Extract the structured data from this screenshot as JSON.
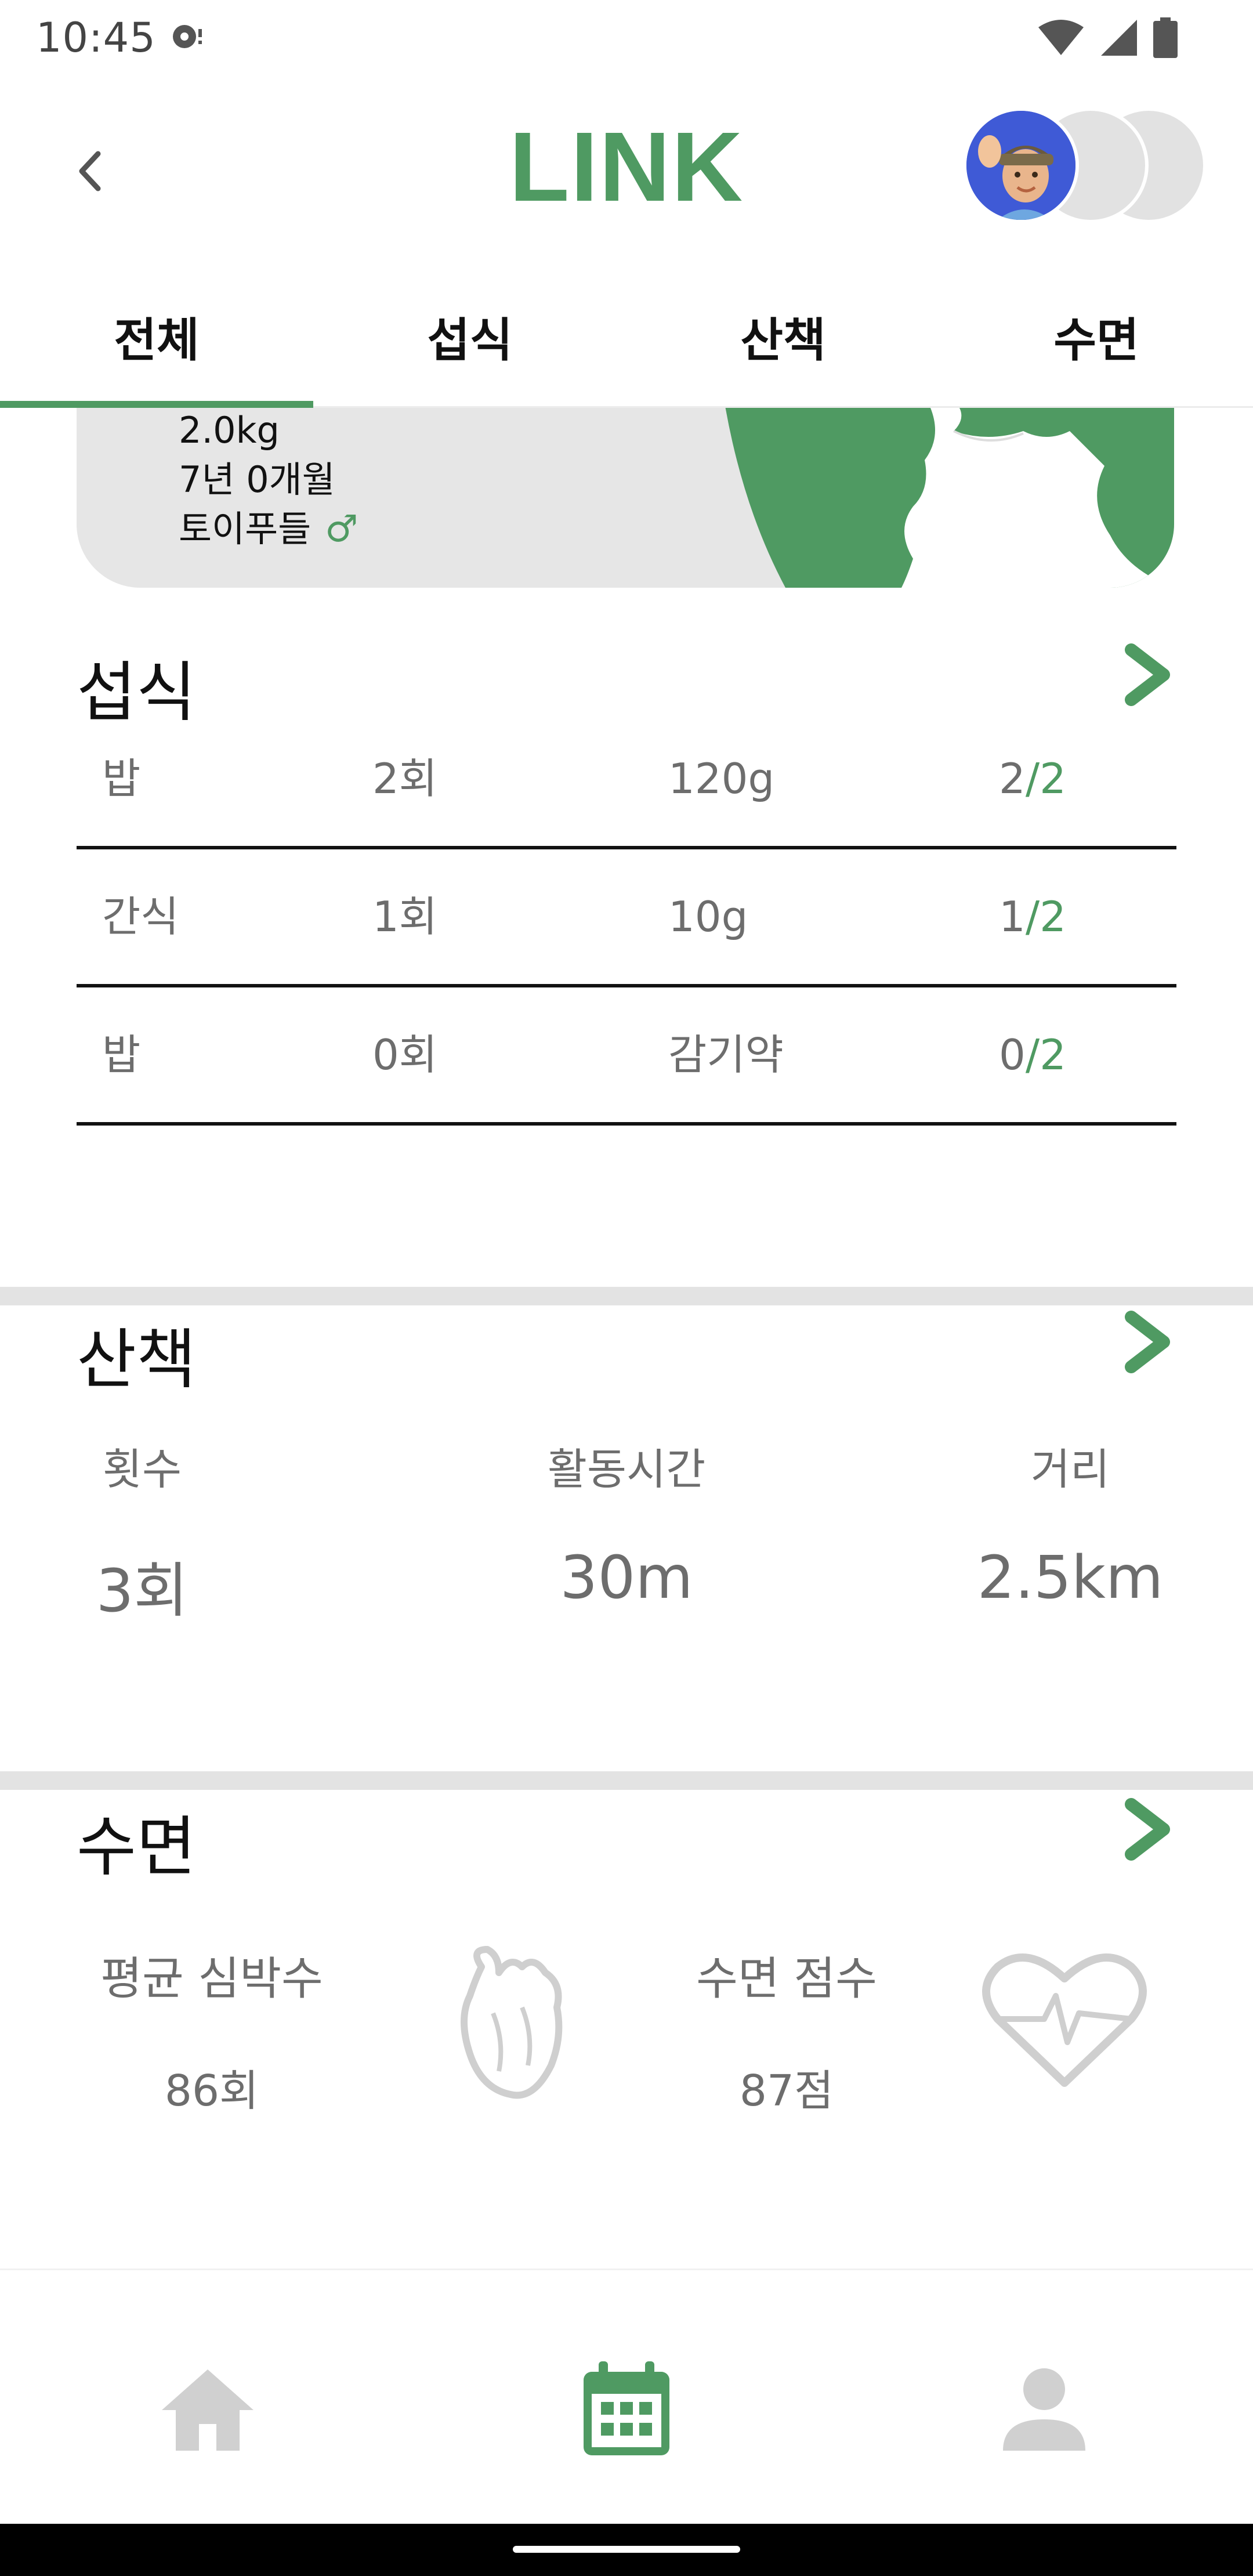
{
  "status_bar": {
    "time": "10:45"
  },
  "header": {
    "logo": "LINK"
  },
  "tabs": [
    {
      "label": "전체",
      "active": true
    },
    {
      "label": "섭식",
      "active": false
    },
    {
      "label": "산책",
      "active": false
    },
    {
      "label": "수면",
      "active": false
    }
  ],
  "pet": {
    "weight": "2.0kg",
    "age": "7년 0개월",
    "breed": "토이푸들",
    "gender_symbol": "♂"
  },
  "feeding": {
    "title": "섭식",
    "rows": [
      {
        "type": "밥",
        "count": "2회",
        "amount": "120g",
        "done": "2",
        "total": "/2"
      },
      {
        "type": "간식",
        "count": "1회",
        "amount": "10g",
        "done": "1",
        "total": "/2"
      },
      {
        "type": "밥",
        "count": "0회",
        "amount": "감기약",
        "done": "0",
        "total": "/2"
      }
    ]
  },
  "walk": {
    "title": "산책",
    "stats": [
      {
        "label": "횟수",
        "value": "3회"
      },
      {
        "label": "활동시간",
        "value": "30m"
      },
      {
        "label": "거리",
        "value": "2.5km"
      }
    ]
  },
  "sleep": {
    "title": "수면",
    "heart_rate_label": "평균 심박수",
    "heart_rate_value": "86회",
    "score_label": "수면 점수",
    "score_value": "87점"
  },
  "colors": {
    "accent": "#4f9a62",
    "band": "#e3e3e3",
    "text_gray": "#6d6d6d"
  },
  "bottom_nav": {
    "items": [
      "home-icon",
      "calendar-icon",
      "person-icon"
    ],
    "active": "calendar-icon"
  }
}
